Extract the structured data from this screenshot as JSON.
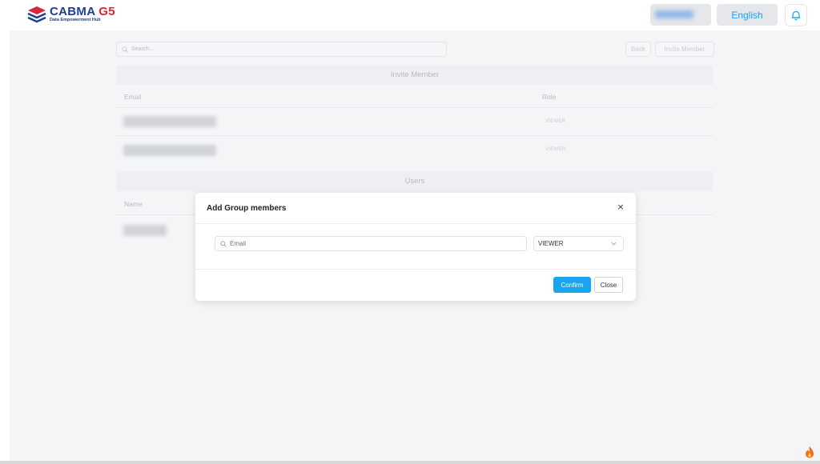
{
  "header": {
    "logo_title_a": "CABMA",
    "logo_title_b": "G5",
    "logo_subtitle": "Data Empowerment Hub",
    "language": "English"
  },
  "toolbar": {
    "search_placeholder": "Search...",
    "back_label": "Back",
    "invite_label": "Invite Member"
  },
  "invite_section": {
    "title": "Invite Member",
    "col_email": "Email",
    "col_role": "Role",
    "rows": [
      {
        "role": "VIEWER"
      },
      {
        "role": "VIEWER"
      }
    ]
  },
  "users_section": {
    "title": "Users",
    "col_name": "Name"
  },
  "modal": {
    "title": "Add Group members",
    "close_glyph": "×",
    "email_placeholder": "Email",
    "role_value": "VIEWER",
    "confirm_label": "Confirm",
    "close_label": "Close"
  },
  "colors": {
    "accent": "#1aa3ef",
    "brand_blue": "#1d3f8f",
    "brand_red": "#d8263a"
  }
}
